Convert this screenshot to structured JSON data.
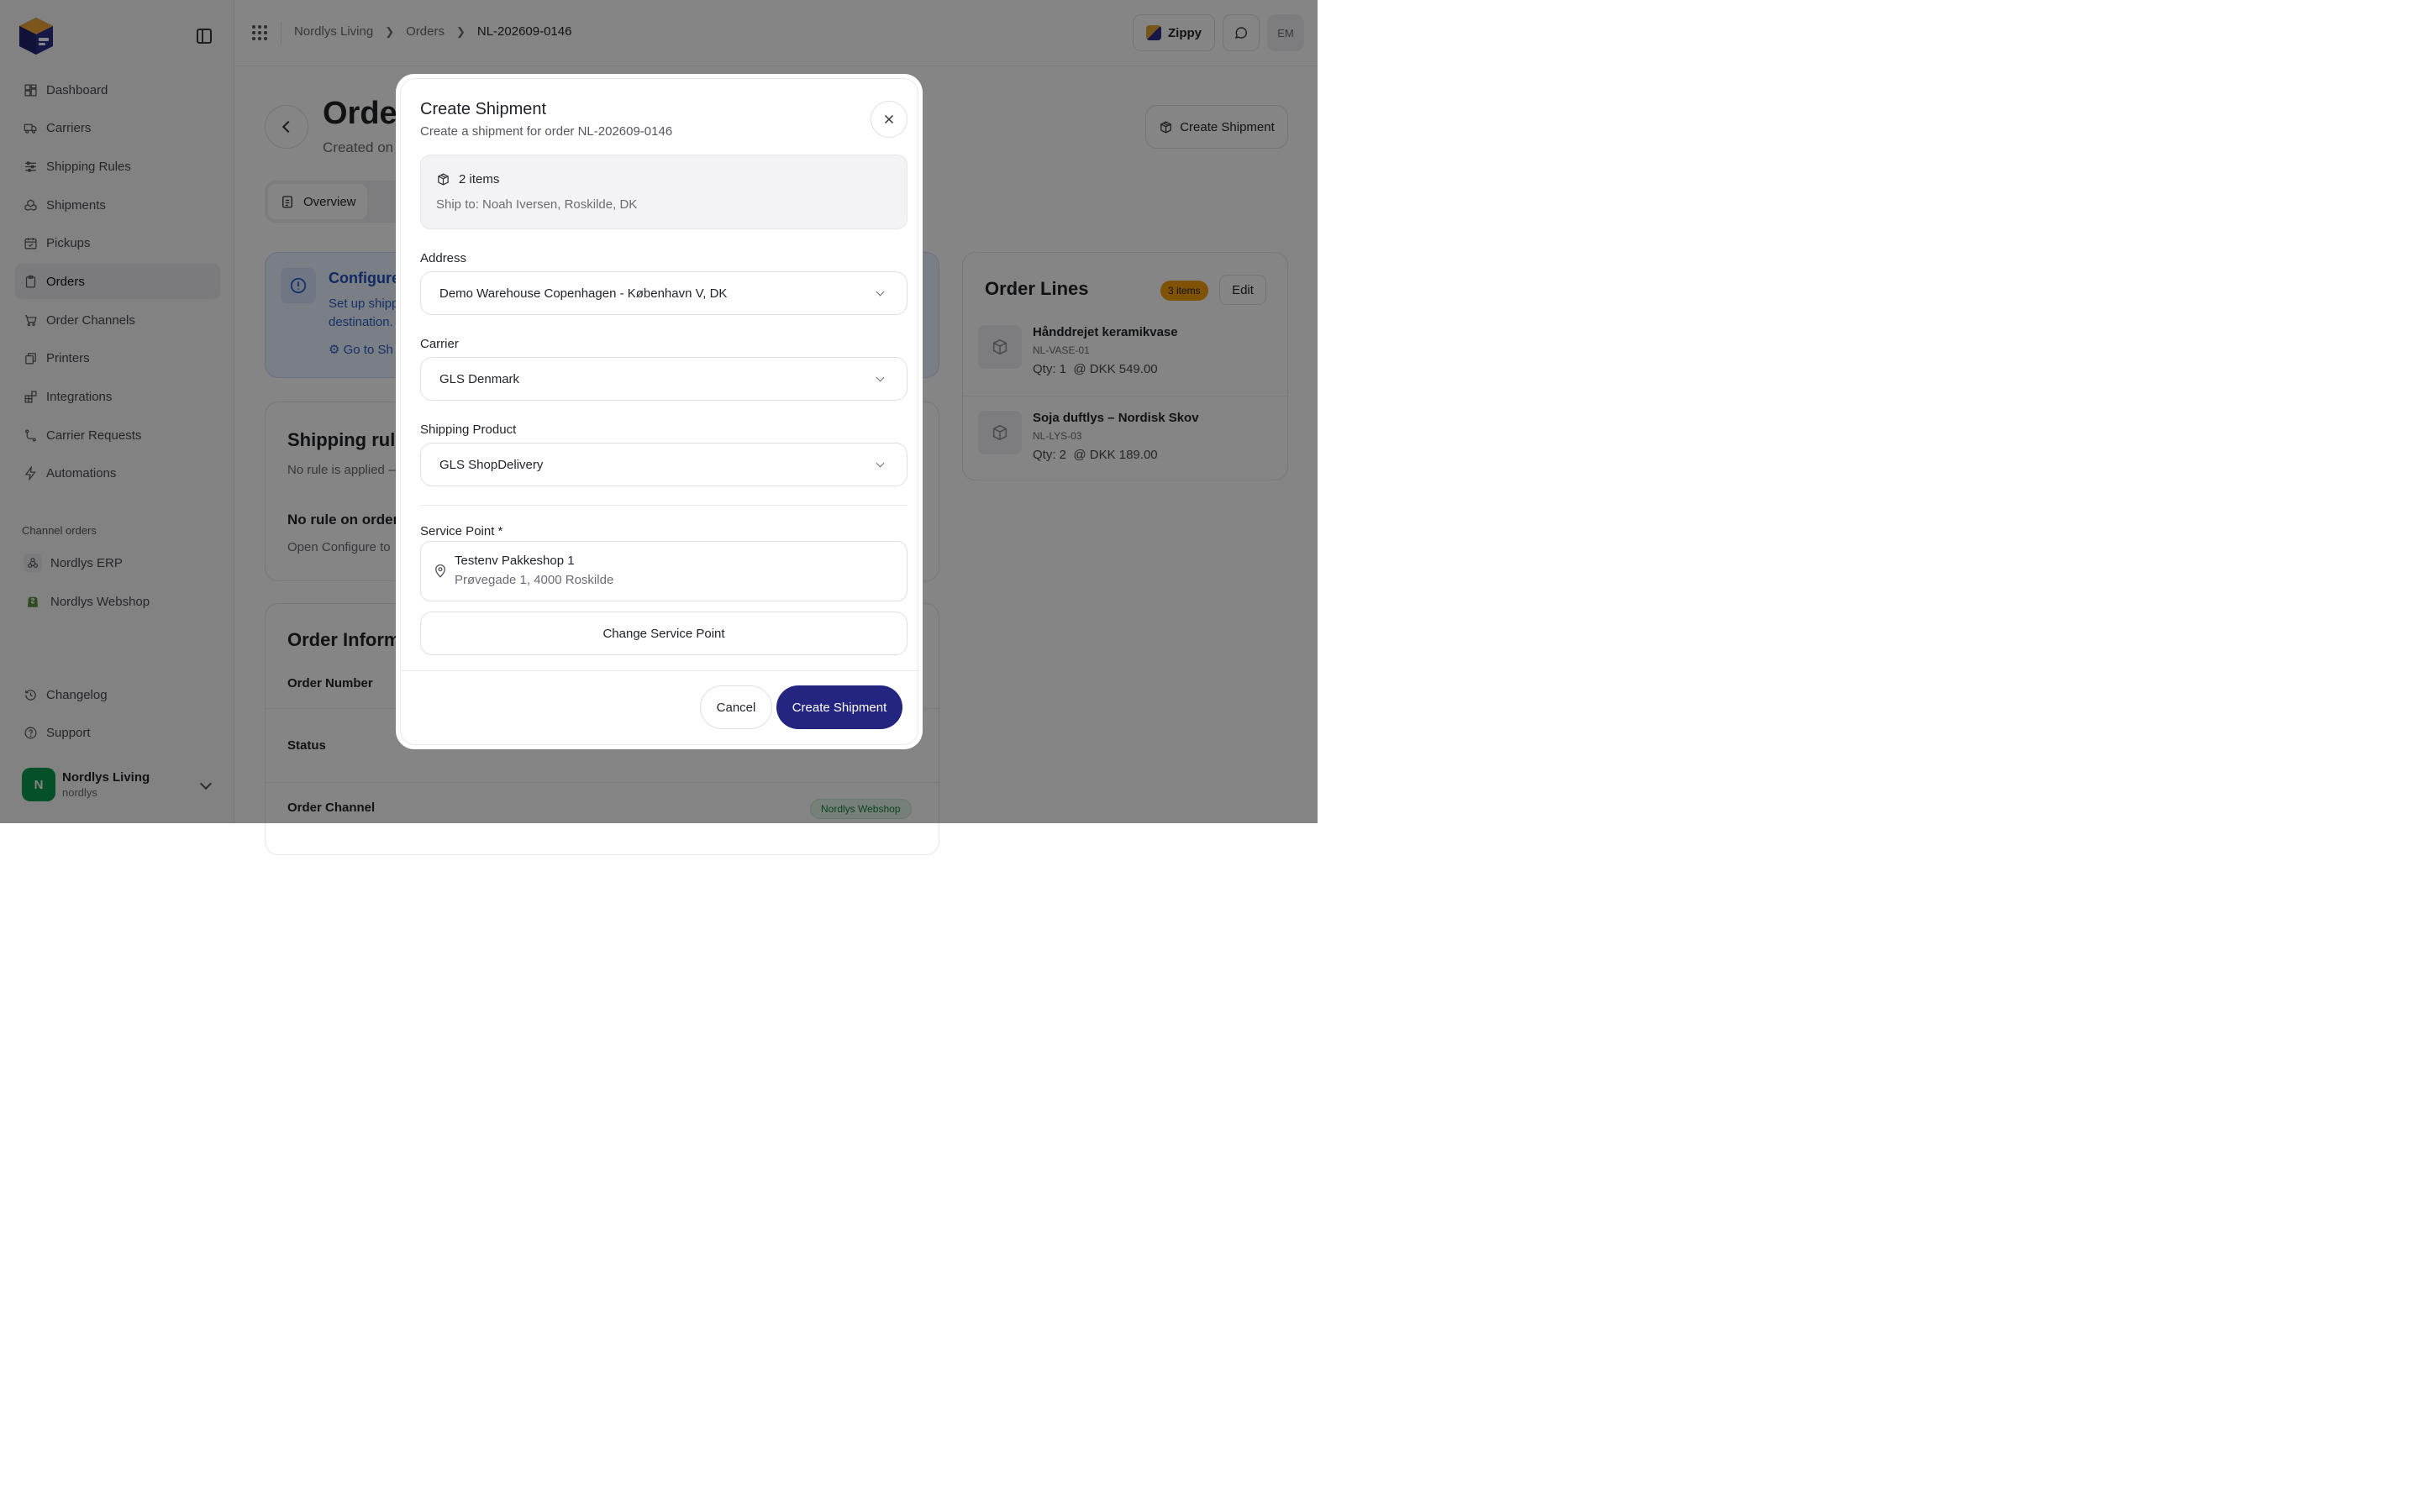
{
  "app": {
    "brand_color": "#232580",
    "accent_orange": "#f59e0b"
  },
  "sidebar": {
    "items": [
      {
        "label": "Dashboard",
        "icon": "dashboard-icon"
      },
      {
        "label": "Carriers",
        "icon": "truck-icon"
      },
      {
        "label": "Shipping Rules",
        "icon": "sliders-icon"
      },
      {
        "label": "Shipments",
        "icon": "boxes-icon"
      },
      {
        "label": "Pickups",
        "icon": "calendar-check-icon"
      },
      {
        "label": "Orders",
        "icon": "clipboard-icon",
        "active": true
      },
      {
        "label": "Order Channels",
        "icon": "cart-icon"
      },
      {
        "label": "Printers",
        "icon": "printer-icon"
      },
      {
        "label": "Integrations",
        "icon": "blocks-icon"
      },
      {
        "label": "Carrier Requests",
        "icon": "route-icon"
      },
      {
        "label": "Automations",
        "icon": "zap-icon"
      }
    ],
    "section_label": "Channel orders",
    "channels": [
      {
        "label": "Nordlys ERP",
        "icon": "webhook-icon"
      },
      {
        "label": "Nordlys Webshop",
        "icon": "shopify-icon"
      }
    ],
    "bottom": [
      {
        "label": "Changelog",
        "icon": "history-icon"
      },
      {
        "label": "Support",
        "icon": "help-circle-icon"
      }
    ],
    "user": {
      "initial": "N",
      "name": "Nordlys Living",
      "handle": "nordlys"
    }
  },
  "topbar": {
    "breadcrumb": [
      "Nordlys Living",
      "Orders",
      "NL-202609-0146"
    ],
    "zippy_label": "Zippy",
    "user_initials": "EM"
  },
  "page": {
    "title": "Orde",
    "subtitle": "Created on",
    "create_label": "Create Shipment",
    "tab_overview": "Overview",
    "info_title": "Configure",
    "info_text": "Set up shipp\ndestination.",
    "info_link": "Go to Sh",
    "rules_title": "Shipping rule",
    "rules_sub": "No rule is applied —",
    "rules_h2": "No rule on order",
    "rules_t2": "Open Configure to",
    "oinfo_title": "Order Informa",
    "order_number_label": "Order Number",
    "status_label": "Status",
    "order_channel_label": "Order Channel",
    "order_channel_value": "Nordlys Webshop",
    "lines_title": "Order Lines",
    "lines_count": "3 items",
    "edit_label": "Edit",
    "lines": [
      {
        "name": "Hånddrejet keramikvase",
        "sku": "NL-VASE-01",
        "qty": "Qty: 1  @ DKK 549.00"
      },
      {
        "name": "Soja duftlys – Nordisk Skov",
        "sku": "NL-LYS-03",
        "qty": "Qty: 2  @ DKK 189.00"
      }
    ]
  },
  "modal": {
    "title": "Create Shipment",
    "subtitle": "Create a shipment for order NL-202609-0146",
    "summary_items": "2 items",
    "summary_ship_to": "Ship to: Noah Iversen, Roskilde, DK",
    "address_label": "Address",
    "address_value": "Demo Warehouse Copenhagen - København V, DK",
    "carrier_label": "Carrier",
    "carrier_value": "GLS Denmark",
    "product_label": "Shipping Product",
    "product_value": "GLS ShopDelivery",
    "service_point_label": "Service Point *",
    "service_point_name": "Testenv Pakkeshop 1",
    "service_point_address": "Prøvegade 1, 4000 Roskilde",
    "change_label": "Change Service Point",
    "cancel_label": "Cancel",
    "create_label": "Create Shipment"
  }
}
